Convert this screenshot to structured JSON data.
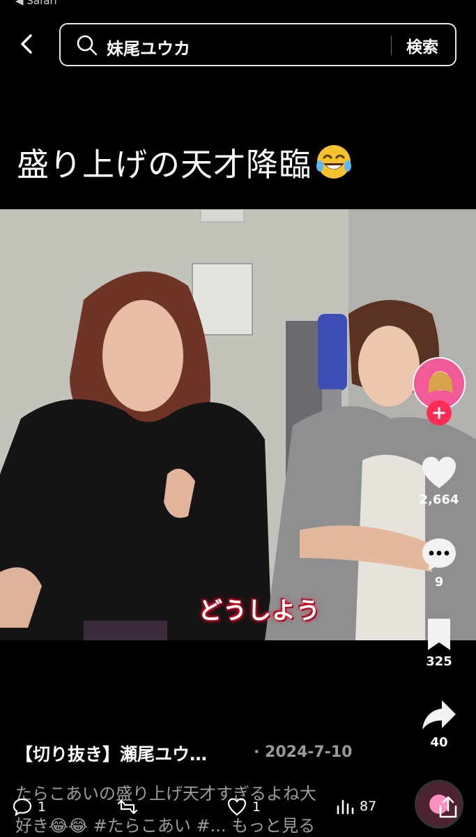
{
  "status_bar": {
    "back_app": "◀ Safari"
  },
  "search": {
    "query": "妹尾ユウカ",
    "submit_label": "検索"
  },
  "video": {
    "caption": "盛り上げの天才降臨",
    "subtitle": "どうしよう"
  },
  "actions": {
    "likes": "2,664",
    "comments": "9",
    "saves": "325",
    "shares": "40"
  },
  "post": {
    "title": "【切り抜き】瀬尾ユウ…",
    "date": "· 2024-7-10",
    "description_line1": "たらこあいの盛り上げ天才すぎるよね大",
    "description_line2": "好き😂😂 #たらこあい #... もっと見る"
  },
  "stats": {
    "replies": "1",
    "reposts": "",
    "likes": "1",
    "views": "87"
  },
  "colors": {
    "accent": "#fe2c55",
    "background": "#000000"
  }
}
